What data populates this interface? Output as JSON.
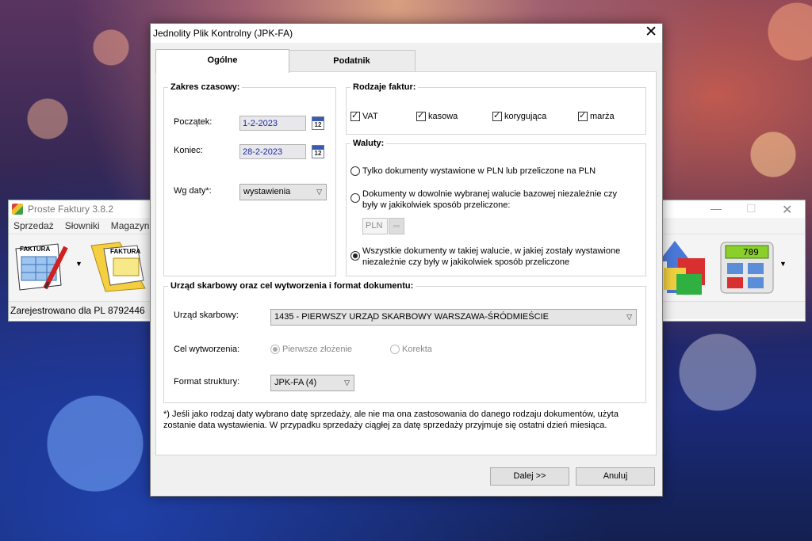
{
  "background_app": {
    "title": "Proste Faktury 3.8.2",
    "menu": [
      "Sprzedaż",
      "Słowniki",
      "Magazyn"
    ],
    "toolbar_labels": [
      "FAKTURA",
      "FAKTURA"
    ],
    "calculator_display": "709",
    "status": "Zarejestrowano dla PL 8792446"
  },
  "dialog": {
    "title": "Jednolity Plik Kontrolny (JPK-FA)",
    "tabs": [
      "Ogólne",
      "Podatnik"
    ],
    "zakres": {
      "legend": "Zakres czasowy:",
      "start_label": "Początek:",
      "start_value": "1-2-2023",
      "end_label": "Koniec:",
      "end_value": "28-2-2023",
      "calendar_glyph": "12",
      "wgdaty_label": "Wg daty*:",
      "wgdaty_value": "wystawienia"
    },
    "rodzaje": {
      "legend": "Rodzaje faktur:",
      "items": [
        "VAT",
        "kasowa",
        "korygująca",
        "marża"
      ]
    },
    "waluty": {
      "legend": "Waluty:",
      "option1": "Tylko dokumenty wystawione w PLN lub przeliczone na PLN",
      "option2_line1": "Dokumenty w dowolnie wybranej walucie bazowej niezależnie czy",
      "option2_line2": "były w jakikolwiek sposób przeliczone:",
      "currency": "PLN",
      "option3_line1": "Wszystkie dokumenty w takiej walucie, w jakiej zostały wystawione",
      "option3_line2": "niezależnie czy były w jakikolwiek sposób przeliczone"
    },
    "urzad": {
      "legend": "Urząd skarbowy oraz cel wytworzenia i format dokumentu:",
      "office_label": "Urząd skarbowy:",
      "office_value": "1435 - PIERWSZY URZĄD SKARBOWY WARSZAWA-ŚRÓDMIEŚCIE",
      "cel_label": "Cel wytworzenia:",
      "cel_opt1": "Pierwsze złożenie",
      "cel_opt2": "Korekta",
      "format_label": "Format struktury:",
      "format_value": "JPK-FA (4)"
    },
    "footnote_line1": "*) Jeśli jako rodzaj daty wybrano datę sprzedaży, ale nie ma ona zastosowania do danego rodzaju dokumentów, użyta",
    "footnote_line2": "zostanie data wystawienia. W przypadku sprzedaży ciągłej za datę sprzedaży przyjmuje się ostatni dzień miesiąca.",
    "next_button": "Dalej >>",
    "cancel_button": "Anuluj"
  }
}
